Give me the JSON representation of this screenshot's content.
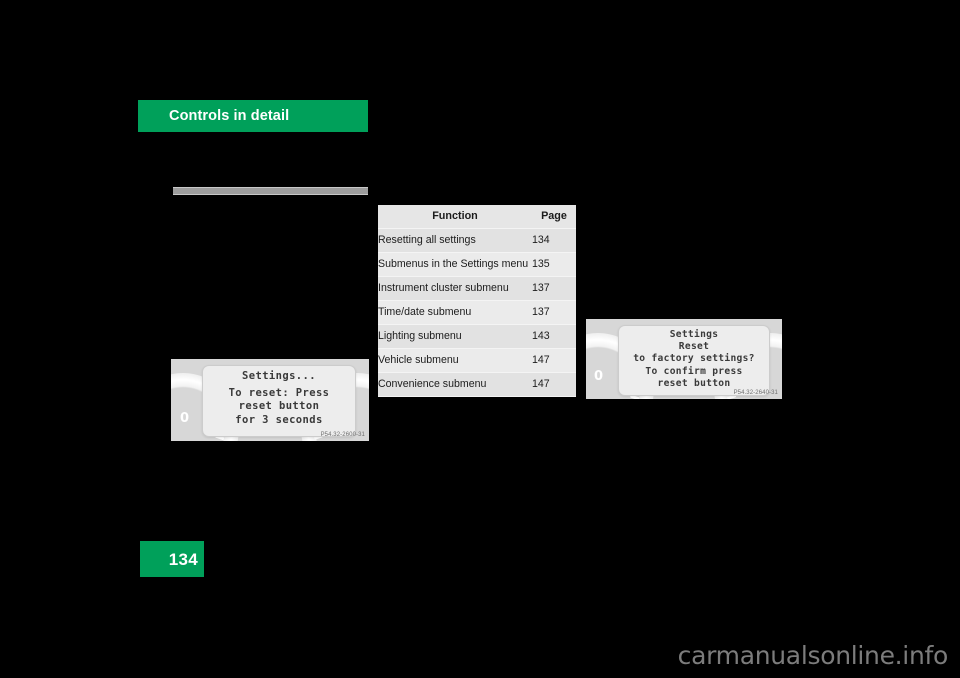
{
  "chapter": {
    "banner_label": "Controls in detail"
  },
  "section": {
    "rule": "horizontal-rule"
  },
  "table": {
    "headers": [
      "Function",
      "Page"
    ],
    "rows": [
      {
        "function": "Resetting all settings",
        "page": "134"
      },
      {
        "function": "Submenus in the Settings menu",
        "page": "135"
      },
      {
        "function": "Instrument cluster submenu",
        "page": "137"
      },
      {
        "function": "Time/date submenu",
        "page": "137"
      },
      {
        "function": "Lighting submenu",
        "page": "143"
      },
      {
        "function": "Vehicle submenu",
        "page": "147"
      },
      {
        "function": "Convenience submenu",
        "page": "147"
      }
    ]
  },
  "figures": {
    "left": {
      "display_lines": [
        "Settings...",
        "To reset: Press",
        "reset button",
        "for 3 seconds"
      ],
      "dial_label": "0",
      "code": "P54.32-2600-31"
    },
    "right": {
      "display_lines": [
        "Settings",
        "Reset",
        "to factory settings?",
        "To confirm press",
        "reset button"
      ],
      "dial_label": "0",
      "code": "P54.32-2640-31"
    }
  },
  "footer": {
    "page_number": "134",
    "watermark": "carmanualsonline.info"
  },
  "colors": {
    "brand_green": "#00a05a",
    "page_background": "#000000",
    "table_header_bg": "#e6e6e6",
    "table_row_bg": "#e2e2e2",
    "figure_bg": "#d7d7d7",
    "lcd_bg": "#ededed"
  }
}
